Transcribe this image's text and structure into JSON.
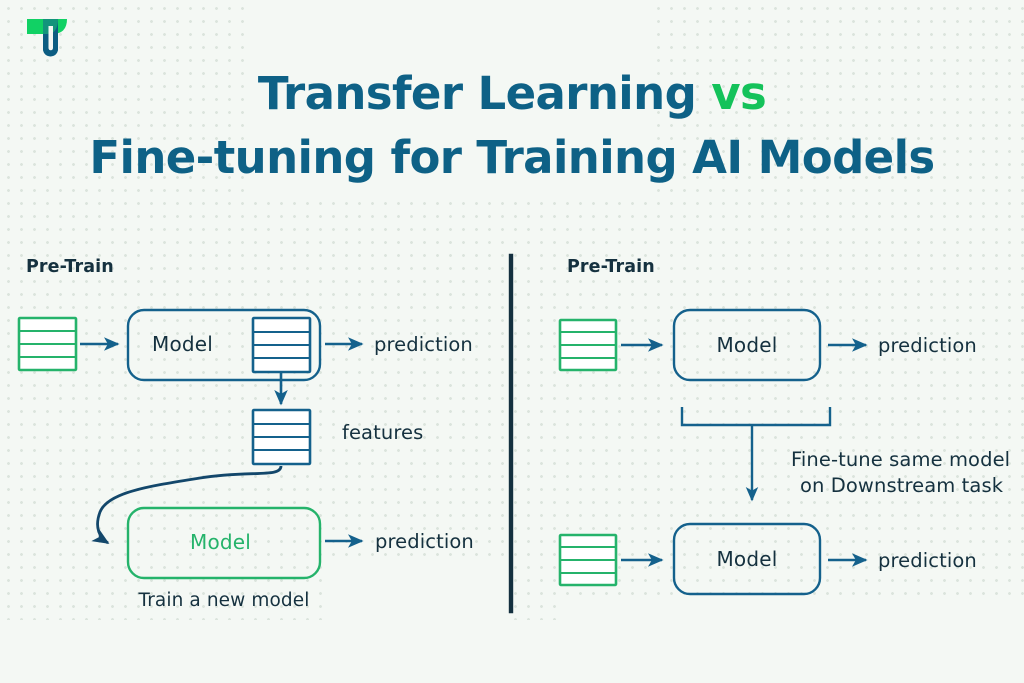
{
  "brand": {
    "logo_icon": "tu-monogram-logo",
    "green": "#14c25a",
    "blue": "#0e6186",
    "dark": "#15313f",
    "accent_green": "#25b36b",
    "background": "#f4f8f4"
  },
  "title": {
    "line1_main": "Transfer Learning ",
    "line1_accent": "vs",
    "line2": "Fine-tuning for Training AI Models"
  },
  "panels": {
    "left": {
      "name": "transfer-learning",
      "pretrain_label": "Pre-Train",
      "model_top_label": "Model",
      "prediction_top_label": "prediction",
      "features_label": "features",
      "model_bottom_label": "Model",
      "prediction_bottom_label": "prediction",
      "caption": "Train a new model"
    },
    "right": {
      "name": "fine-tuning",
      "pretrain_label": "Pre-Train",
      "model_top_label": "Model",
      "prediction_top_label": "prediction",
      "note_line1": "Fine-tune same model",
      "note_line2": "on Downstream task",
      "model_bottom_label": "Model",
      "prediction_bottom_label": "prediction"
    }
  },
  "icons": {
    "data_table_green": "data-table-icon",
    "data_table_blue": "data-table-icon",
    "arrow_right": "arrow-right-icon",
    "arrow_down": "arrow-down-icon",
    "curved_arrow": "curved-arrow-icon",
    "divider": "vertical-divider"
  }
}
